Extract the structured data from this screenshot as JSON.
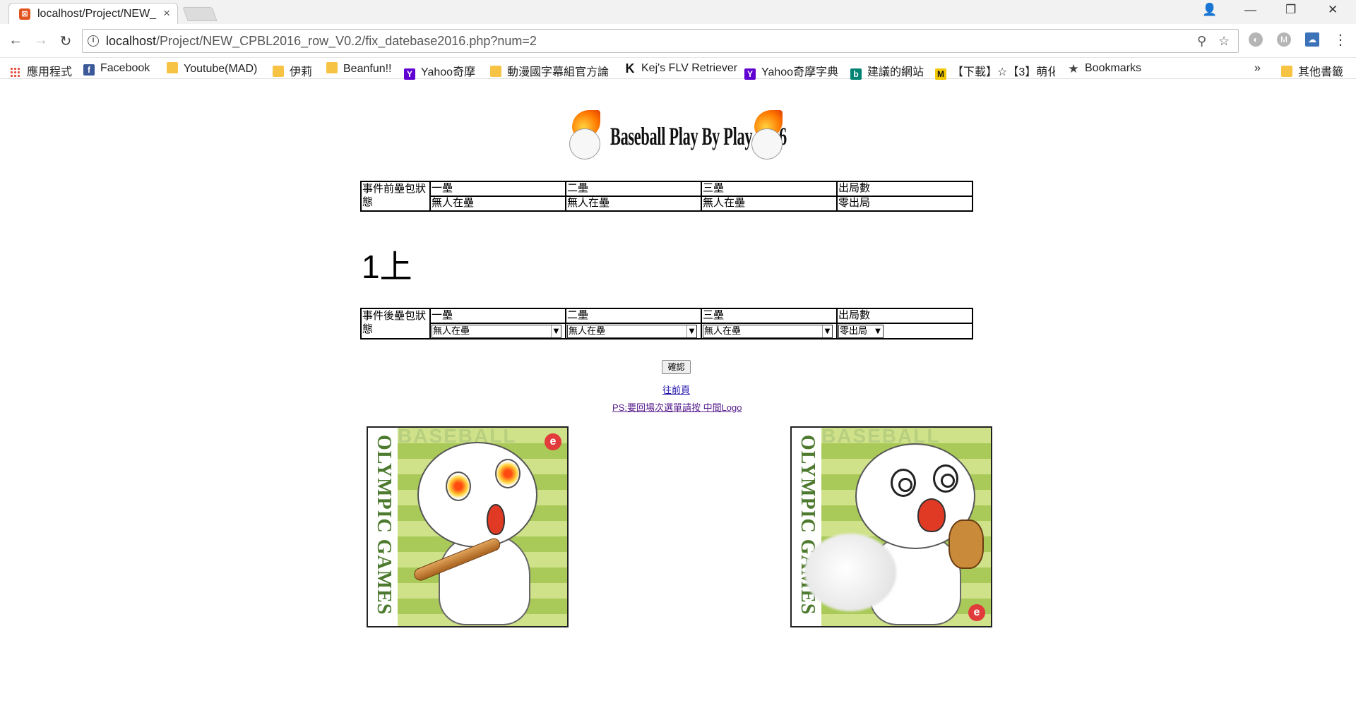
{
  "browser": {
    "tab": {
      "title": "localhost/Project/NEW_",
      "close_icon": "×"
    },
    "window_controls": {
      "profile": "👤",
      "minimize": "—",
      "restore": "❐",
      "close": "✕"
    },
    "nav": {
      "back": "←",
      "forward": "→",
      "reload": "↻"
    },
    "url": {
      "host": "localhost",
      "path": "/Project/NEW_CPBL2016_row_V0.2/fix_datebase2016.php?num=2"
    },
    "omnibox_icons": {
      "zoom": "⚲",
      "bookmark": "☆"
    },
    "extensions": [
      "◐",
      "M",
      "☁"
    ],
    "menu": "⋮"
  },
  "bookmarks": {
    "items": [
      {
        "label": "應用程式",
        "icon": "apps"
      },
      {
        "label": "Facebook",
        "icon": "f"
      },
      {
        "label": "Youtube(MAD)",
        "icon": "folder"
      },
      {
        "label": "伊莉",
        "icon": "folder"
      },
      {
        "label": "Beanfun!!",
        "icon": "folder"
      },
      {
        "label": "Yahoo奇摩",
        "icon": "Y"
      },
      {
        "label": "動漫國字幕組官方論",
        "icon": "folder"
      },
      {
        "label": "Kej's FLV Retriever",
        "icon": "K"
      },
      {
        "label": "Yahoo奇摩字典",
        "icon": "Y"
      },
      {
        "label": "建議的網站",
        "icon": "b"
      },
      {
        "label": "【下載】☆【3】萌化",
        "icon": "M"
      },
      {
        "label": "Bookmarks",
        "icon": "★"
      }
    ],
    "overflow": "»",
    "other": "其他書籤"
  },
  "page": {
    "banner": "Baseball Play By Play 2016",
    "before_table": {
      "label": "事件前壘包狀態",
      "headers": [
        "一壘",
        "二壘",
        "三壘",
        "出局數"
      ],
      "values": [
        "無人在壘",
        "無人在壘",
        "無人在壘",
        "零出局"
      ]
    },
    "inning": "1上",
    "after_table": {
      "label": "事件後壘包狀態",
      "headers": [
        "一壘",
        "二壘",
        "三壘",
        "出局數"
      ],
      "selects": [
        "無人在壘",
        "無人在壘",
        "無人在壘",
        "零出局"
      ],
      "select_arrow": "▼"
    },
    "confirm_button": "確認",
    "prev_link": "往前頁",
    "note_link": "PS:要回場次選單請按 中間Logo",
    "cards": [
      {
        "side_text": "OLYMPIC GAMES",
        "top_text": "BASEBALL",
        "badge": "e"
      },
      {
        "side_text": "OLYMPIC GAMES",
        "top_text": "BASEBALL",
        "badge": "e"
      }
    ]
  }
}
